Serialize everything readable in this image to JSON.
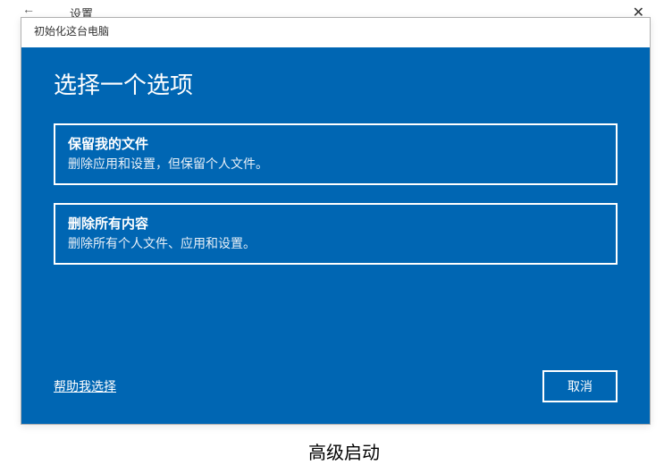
{
  "background": {
    "settings_title": "设置",
    "back_arrow": "←",
    "close_glyph": "✕",
    "section_below": "高级启动"
  },
  "dialog": {
    "window_title": "初始化这台电脑",
    "heading": "选择一个选项",
    "options": [
      {
        "title": "保留我的文件",
        "description": "删除应用和设置，但保留个人文件。"
      },
      {
        "title": "删除所有内容",
        "description": "删除所有个人文件、应用和设置。"
      }
    ],
    "help_link": "帮助我选择",
    "cancel": "取消"
  }
}
